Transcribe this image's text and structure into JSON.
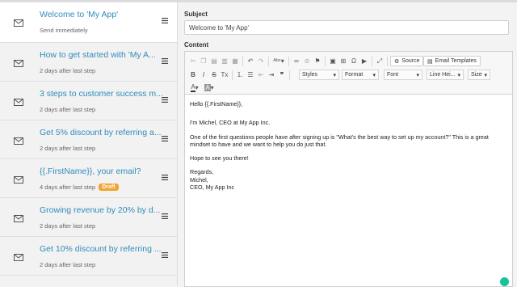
{
  "steps": [
    {
      "title": "Welcome to 'My App'",
      "sub": "Send immediately",
      "badge": ""
    },
    {
      "title": "How to get started with 'My A...",
      "sub": "2 days after last step",
      "badge": ""
    },
    {
      "title": "3 steps to customer success m...",
      "sub": "2 days after last step",
      "badge": ""
    },
    {
      "title": "Get 5% discount by referring a...",
      "sub": "2 days after last step",
      "badge": ""
    },
    {
      "title": "{{.FirstName}}, your email?",
      "sub": "4 days after last step",
      "badge": "Draft"
    },
    {
      "title": "Growing revenue by 20% by d...",
      "sub": "2 days after last step",
      "badge": ""
    },
    {
      "title": "Get 10% discount by referring ...",
      "sub": "2 days after last step",
      "badge": ""
    }
  ],
  "form": {
    "subject_label": "Subject",
    "subject_value": "Welcome to 'My App'",
    "content_label": "Content"
  },
  "toolbar": {
    "source": "Source",
    "email_templates": "Email Templates",
    "styles": "Styles",
    "format": "Format",
    "font": "Font",
    "line_height": "Line Hei...",
    "size": "Size"
  },
  "body": {
    "greeting": "Hello {{.FirstName}},",
    "intro": "I'm Michel, CEO at My App Inc.",
    "para": "One of the first questions people have after signing up is \"What's the best way to set up my account?\" This is a great mindset to have and we want to help you do just that.",
    "hope": "Hope to see you there!",
    "regards": "Regards,",
    "name": "Michel,",
    "title": "CEO, My App Inc"
  }
}
